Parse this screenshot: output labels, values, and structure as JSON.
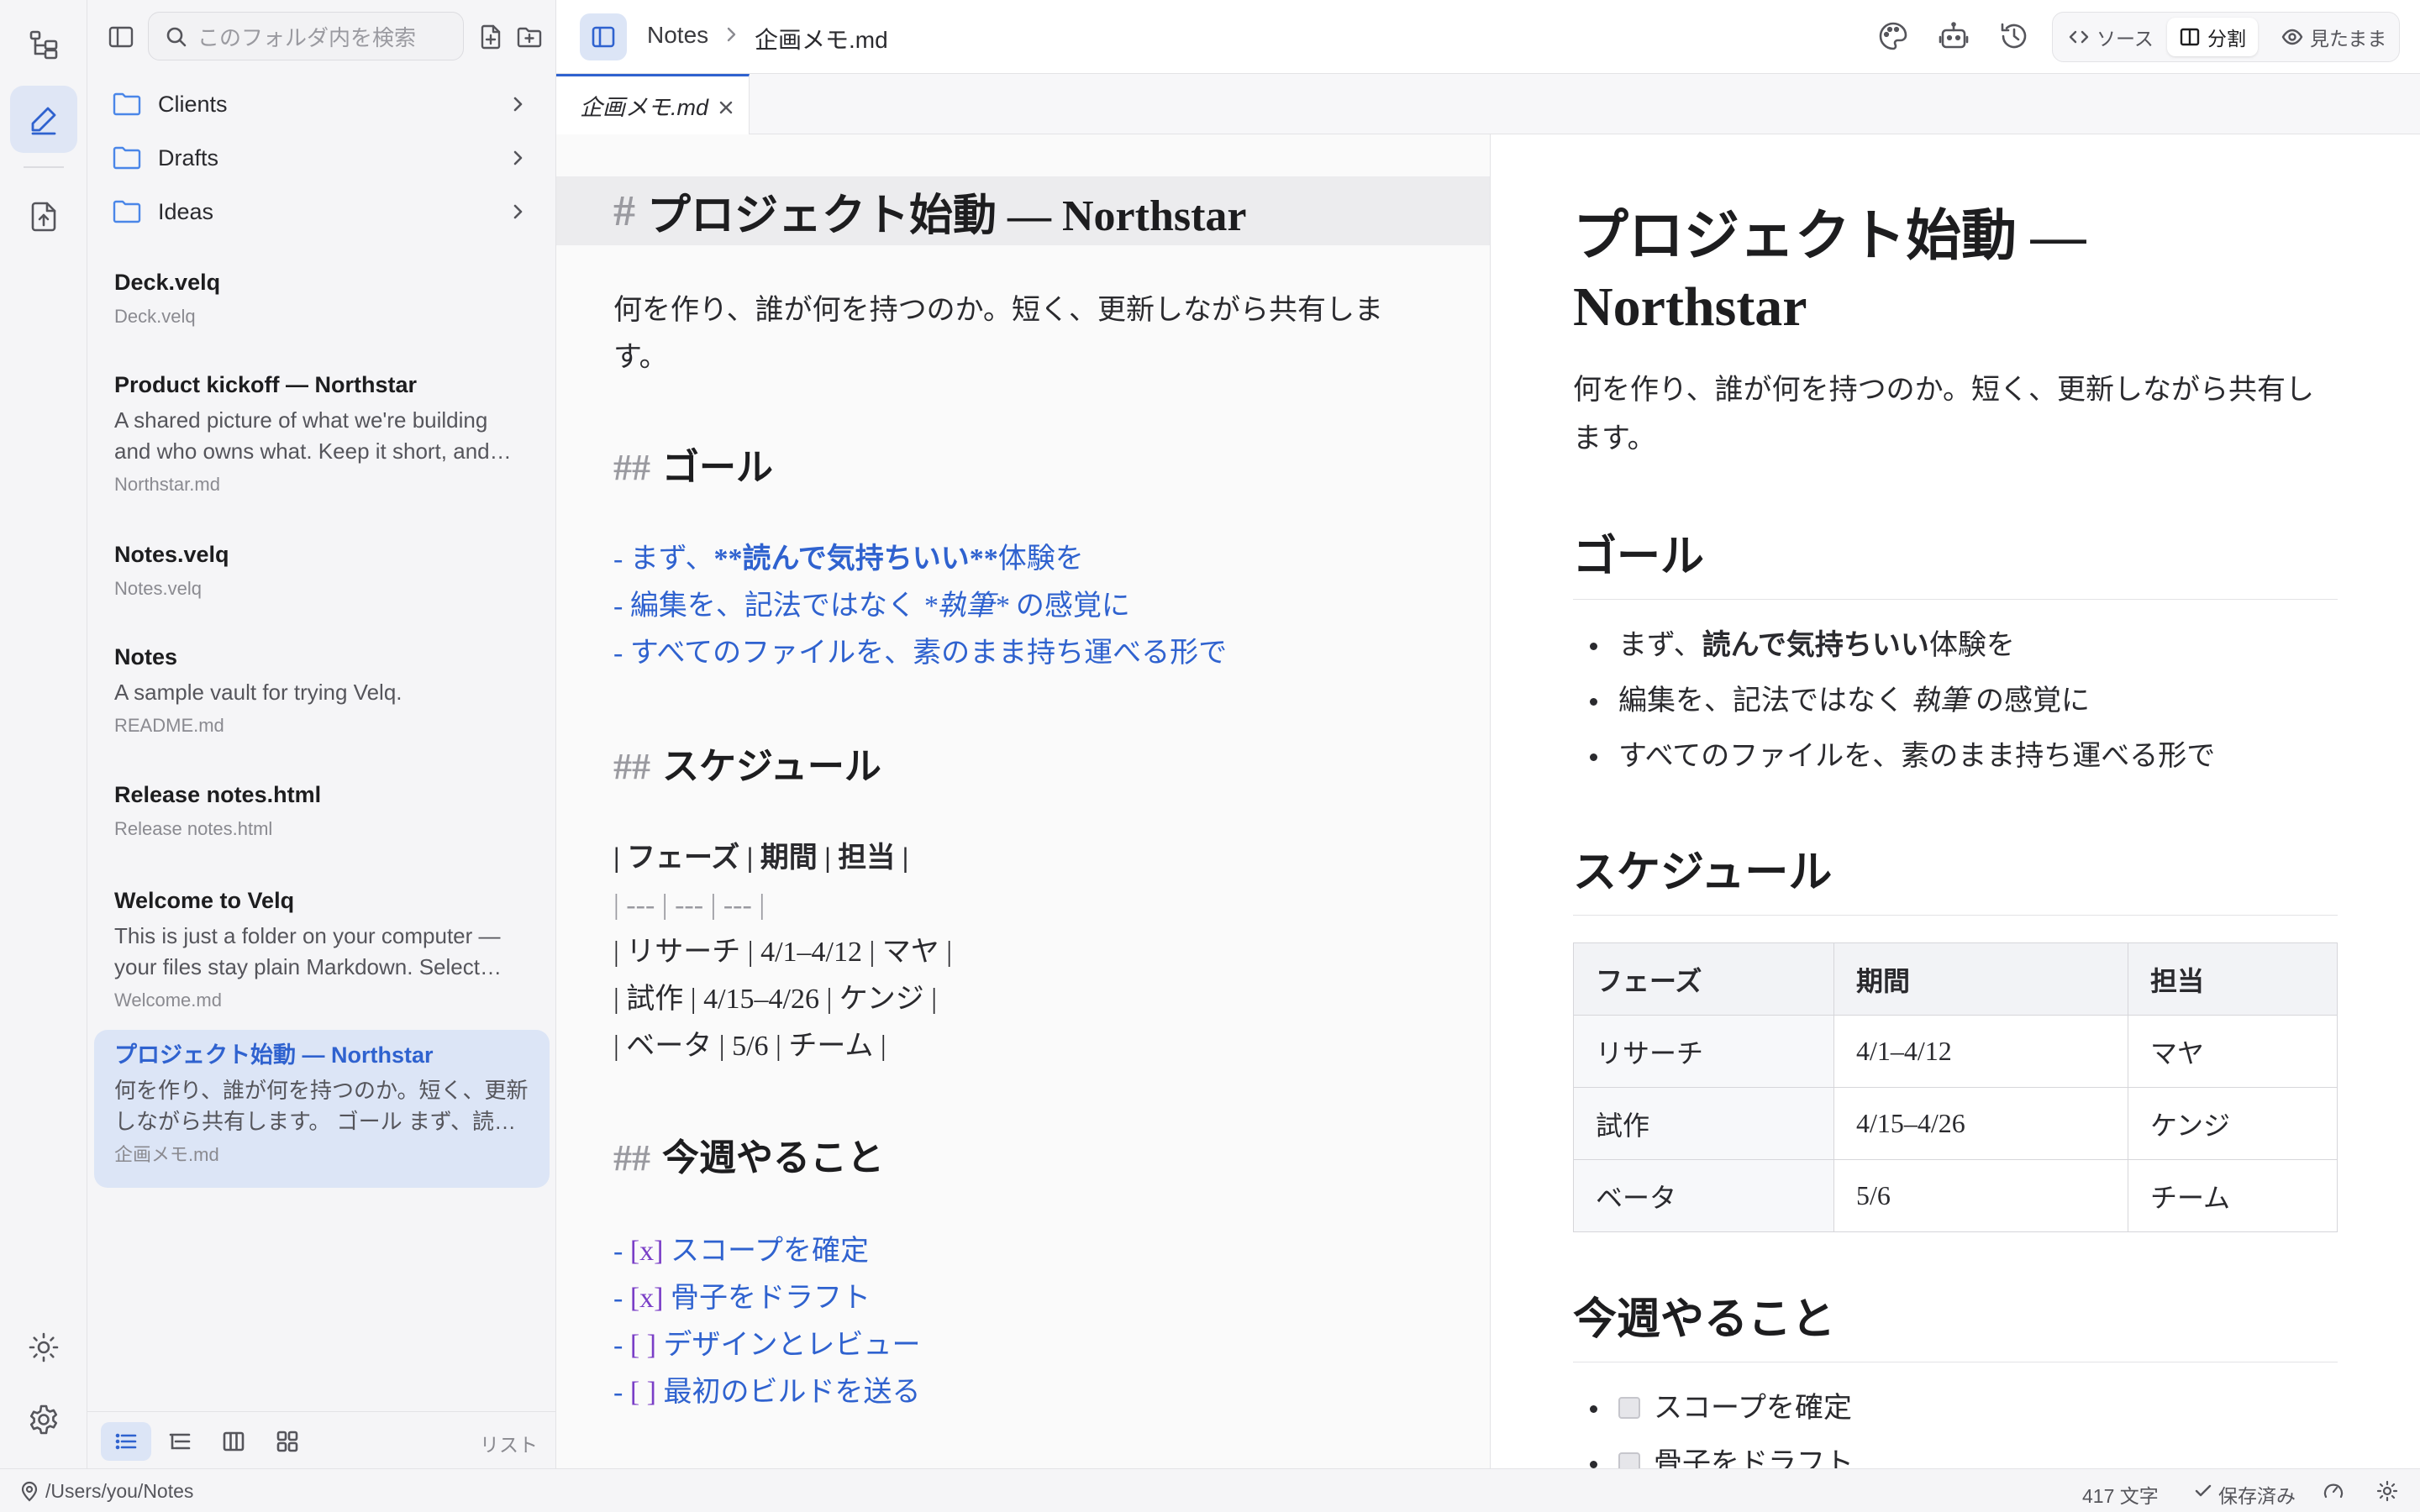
{
  "search": {
    "placeholder": "このフォルダ内を検索"
  },
  "folders": [
    {
      "name": "Clients"
    },
    {
      "name": "Drafts"
    },
    {
      "name": "Ideas"
    }
  ],
  "notes": [
    {
      "title": "Deck.velq",
      "excerpt_lines": [],
      "file": "Deck.velq"
    },
    {
      "title": "Product kickoff — Northstar",
      "excerpt_lines": [
        "A shared picture of what we're building",
        "and who owns what. Keep it short, and…"
      ],
      "file": "Northstar.md"
    },
    {
      "title": "Notes.velq",
      "excerpt_lines": [],
      "file": "Notes.velq"
    },
    {
      "title": "Notes",
      "excerpt_lines": [
        "A sample vault for trying Velq."
      ],
      "file": "README.md"
    },
    {
      "title": "Release notes.html",
      "excerpt_lines": [],
      "file": "Release notes.html"
    },
    {
      "title": "Welcome to Velq",
      "excerpt_lines": [
        "This is just a folder on your computer —",
        "your files stay plain Markdown. Select…"
      ],
      "file": "Welcome.md"
    },
    {
      "title": "プロジェクト始動 — Northstar",
      "excerpt_lines": [
        "何を作り、誰が何を持つのか。短く、更新",
        "しながら共有します。 ゴール まず、読…"
      ],
      "file": "企画メモ.md",
      "selected": true
    }
  ],
  "sidebar_footer": {
    "view_label": "リスト"
  },
  "breadcrumb": {
    "root": "Notes",
    "file": "企画メモ.md"
  },
  "view_modes": {
    "source": "ソース",
    "split": "分割",
    "preview": "見たまま",
    "active": "split"
  },
  "tab": {
    "label": "企画メモ.md"
  },
  "editor": {
    "h1_hash": "#",
    "h1": "プロジェクト始動 — Northstar",
    "intro_lines": [
      "何を作り、誰が何を持つのか。短く、更新しながら共有しま",
      "す。"
    ],
    "h2_hash": "##",
    "goal_heading": "ゴール",
    "goal_lines": [
      {
        "pre": "- まず、",
        "bold": "**読んで気持ちいい**",
        "post": "体験を"
      },
      {
        "pre": "- 編集を、記法ではなく ",
        "italic": "*執筆*",
        "post": " の感覚に"
      },
      {
        "pre": "- すべてのファイルを、素のまま持ち運べる形で"
      }
    ],
    "schedule_heading": "スケジュール",
    "table_lines": [
      "| フェーズ | 期間 | 担当 |",
      "| --- | --- | --- |",
      "| リサーチ | 4/1–4/12 | マヤ |",
      "| 試作 | 4/15–4/26 | ケンジ |",
      "| ベータ | 5/6 | チーム |"
    ],
    "todo_heading": "今週やること",
    "todo_lines": [
      {
        "mark": "[x]",
        "text": "スコープを確定"
      },
      {
        "mark": "[x]",
        "text": "骨子をドラフト"
      },
      {
        "mark": "[ ]",
        "text": "デザインとレビュー"
      },
      {
        "mark": "[ ]",
        "text": "最初のビルドを送る"
      }
    ]
  },
  "preview": {
    "h1_lines": [
      "プロジェクト始動 —",
      "Northstar"
    ],
    "intro_lines": [
      "何を作り、誰が何を持つのか。短く、更新しながら共有し",
      "ます。"
    ],
    "goal_heading": "ゴール",
    "goals": [
      {
        "pre": "まず、",
        "bold": "読んで気持ちいい",
        "post": "体験を"
      },
      {
        "pre": "編集を、記法ではなく ",
        "italic": "執筆",
        "post": " の感覚に"
      },
      {
        "pre": "すべてのファイルを、素のまま持ち運べる形で"
      }
    ],
    "schedule_heading": "スケジュール",
    "table": {
      "headers": [
        "フェーズ",
        "期間",
        "担当"
      ],
      "rows": [
        [
          "リサーチ",
          "4/1–4/12",
          "マヤ"
        ],
        [
          "試作",
          "4/15–4/26",
          "ケンジ"
        ],
        [
          "ベータ",
          "5/6",
          "チーム"
        ]
      ]
    },
    "todo_heading": "今週やること",
    "todos": [
      {
        "text": "スコープを確定",
        "checked": true
      },
      {
        "text": "骨子をドラフト",
        "checked": true
      }
    ]
  },
  "status": {
    "path": "/Users/you/Notes",
    "char_count": "417 文字",
    "saved": "保存済み"
  },
  "colors": {
    "accent": "#2f62cf",
    "selection": "#dce5f6",
    "task_mark": "#7a3fc7"
  }
}
